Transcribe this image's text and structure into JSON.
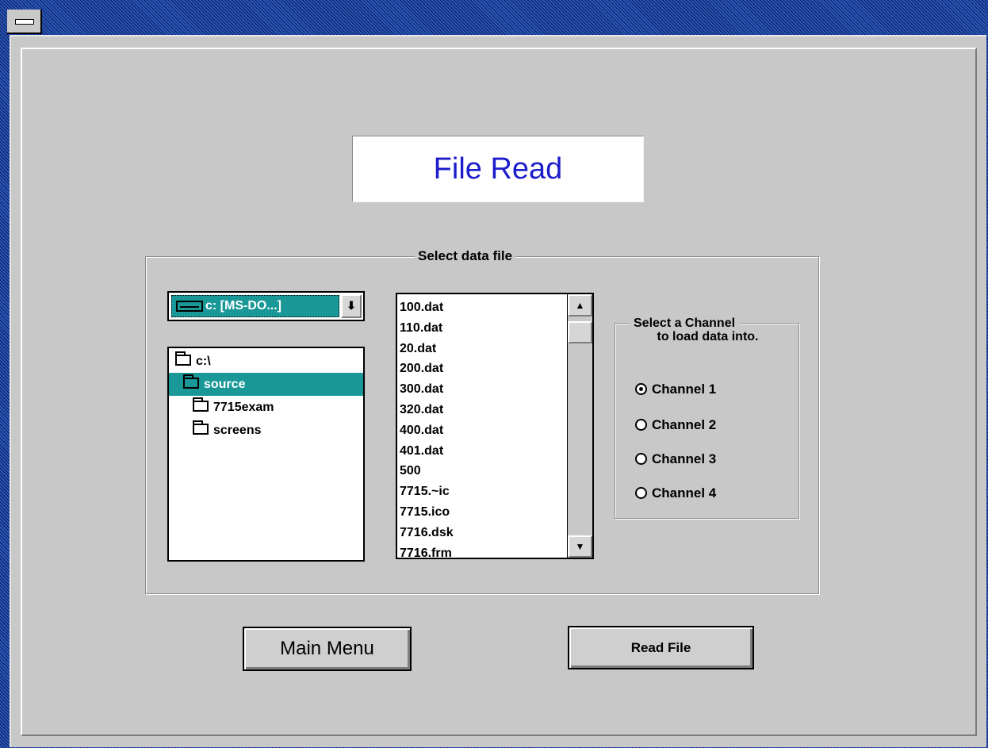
{
  "window": {
    "system_menu_icon": "system-menu-icon"
  },
  "page": {
    "title": "File Read"
  },
  "file_select": {
    "group_label": "Select data file",
    "drive": {
      "selected": "c: [MS-DO...]",
      "icon": "drive-icon",
      "dropdown_icon": "arrow-down-icon"
    },
    "directories": [
      {
        "name": "c:\\",
        "icon": "open-folder-icon",
        "selected": false,
        "indent": 0
      },
      {
        "name": "source",
        "icon": "open-folder-icon",
        "selected": true,
        "indent": 0
      },
      {
        "name": "7715exam",
        "icon": "folder-icon",
        "selected": false,
        "indent": 1
      },
      {
        "name": "screens",
        "icon": "folder-icon",
        "selected": false,
        "indent": 1
      }
    ],
    "files": [
      "100.dat",
      "110.dat",
      "20.dat",
      "200.dat",
      "300.dat",
      "320.dat",
      "400.dat",
      "401.dat",
      "500",
      "7715.~ic",
      "7715.ico",
      "7716.dsk",
      "7716.frm"
    ]
  },
  "channel_select": {
    "label_line1": "Select a Channel",
    "label_line2": "to load data into.",
    "options": [
      {
        "label": "Channel 1",
        "selected": true
      },
      {
        "label": "Channel 2",
        "selected": false
      },
      {
        "label": "Channel 3",
        "selected": false
      },
      {
        "label": "Channel 4",
        "selected": false
      }
    ]
  },
  "buttons": {
    "main_menu": "Main Menu",
    "read_file": "Read File"
  },
  "colors": {
    "selection": "#1a9898",
    "title_text": "#1c1ccc",
    "face": "#c8c8c8"
  }
}
